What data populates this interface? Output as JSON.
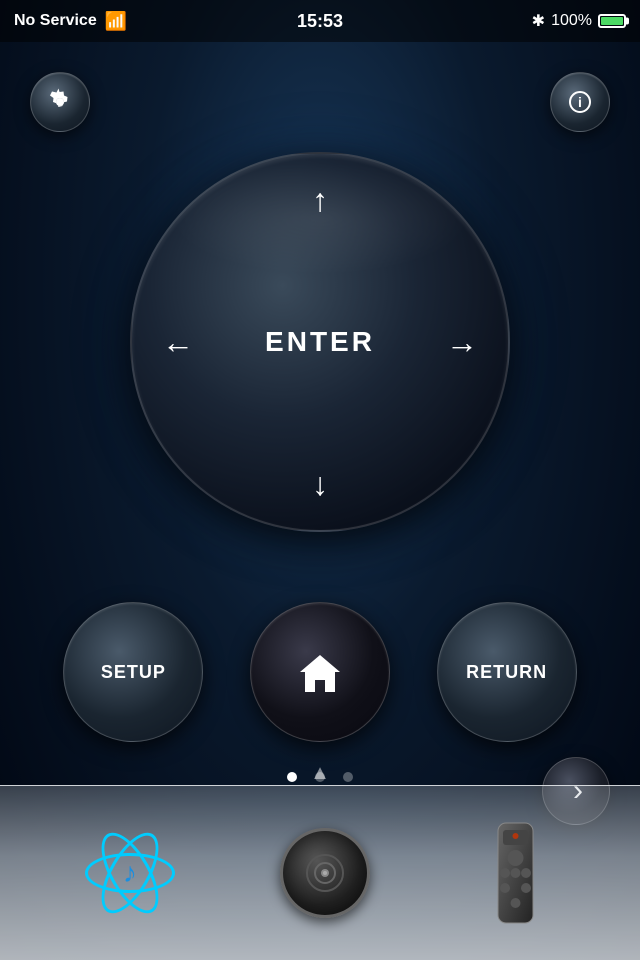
{
  "statusBar": {
    "noService": "No Service",
    "time": "15:53",
    "batteryPercent": "100%"
  },
  "topButtons": {
    "settingsLabel": "⚙",
    "infoLabel": "ⓘ"
  },
  "dpad": {
    "enterLabel": "ENTER"
  },
  "actionButtons": {
    "setupLabel": "SETUP",
    "homeLabel": "🏠",
    "returnLabel": "RETURN"
  },
  "navigation": {
    "nextLabel": "›",
    "dots": [
      true,
      false,
      false
    ]
  },
  "dock": {
    "items": [
      "music",
      "speaker",
      "remote"
    ]
  }
}
